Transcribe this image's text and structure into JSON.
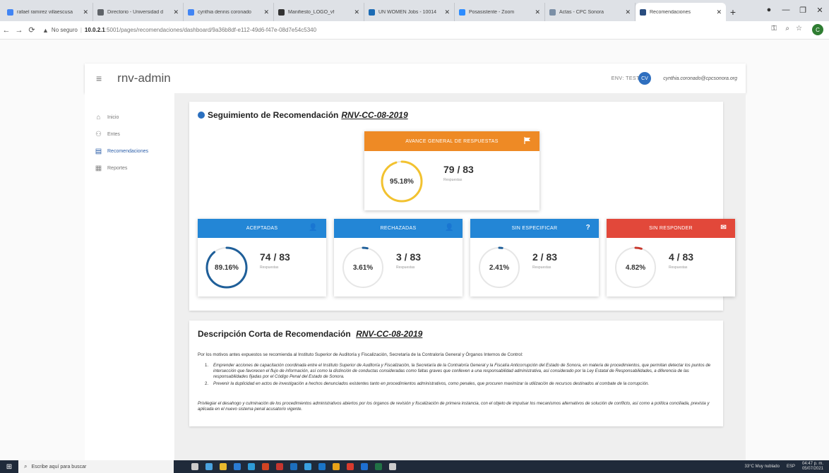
{
  "browser": {
    "tabs": [
      {
        "label": "rafael ramirez villaescusa",
        "color": "#4285f4"
      },
      {
        "label": "Directorio - Universidad d",
        "color": "#5f6368"
      },
      {
        "label": "cynthia dennis coronado",
        "color": "#4285f4"
      },
      {
        "label": "Manifiesto_LOGO_vf",
        "color": "#333333"
      },
      {
        "label": "UN WOMEN Jobs - 10014",
        "color": "#1c6bb4"
      },
      {
        "label": "Posasistente - Zoom",
        "color": "#2d8cff"
      },
      {
        "label": "Actas - CPC Sonora",
        "color": "#7b8fa6"
      },
      {
        "label": "Recomendaciones",
        "color": "#2a4d7f",
        "active": true
      }
    ],
    "url_security": "No seguro",
    "url_host": "10.0.2.1",
    "url_path": ":5001/pages/recomendaciones/dashboard/9a36b8df-e112-49d6-f47e-08d7e54c5340",
    "profile_initial": "C"
  },
  "app": {
    "name": "rnv-admin",
    "env": "ENV: TEST",
    "user_initials": "CV",
    "user_email": "cynthia.coronado@cpcsonora.org"
  },
  "sidebar": {
    "items": [
      {
        "label": "Inicio",
        "icon": "home-icon"
      },
      {
        "label": "Entes",
        "icon": "users-icon"
      },
      {
        "label": "Recomendaciones",
        "icon": "document-icon",
        "active": true
      },
      {
        "label": "Reportes",
        "icon": "calendar-icon"
      }
    ]
  },
  "tracking": {
    "title": "Seguimiento de Recomendación",
    "code": "RNV-CC-08-2019",
    "general": {
      "header": "AVANCE GENERAL DE RESPUESTAS",
      "percent_label": "95.18%",
      "percent": 95.18,
      "fraction": "79 / 83",
      "sub": "Respuestas",
      "color": "#ee8a25",
      "ring_color": "#f2c230"
    },
    "stats": [
      {
        "header": "ACEPTADAS",
        "fraction": "74 / 83",
        "percent_label": "89.16%",
        "percent": 89.16,
        "sub": "Respuestas",
        "color": "#2386d6",
        "ring_color": "#1f5f99",
        "icon": "user-check-icon",
        "glyph": "👤"
      },
      {
        "header": "RECHAZADAS",
        "fraction": "3 / 83",
        "percent_label": "3.61%",
        "percent": 3.61,
        "sub": "Respuestas",
        "color": "#2386d6",
        "ring_color": "#1f5f99",
        "icon": "user-x-icon",
        "glyph": "👤"
      },
      {
        "header": "SIN ESPECIFICAR",
        "fraction": "2 / 83",
        "percent_label": "2.41%",
        "percent": 2.41,
        "sub": "Respuestas",
        "color": "#2386d6",
        "ring_color": "#1f5f99",
        "icon": "question-icon",
        "glyph": "?"
      },
      {
        "header": "SIN RESPONDER",
        "fraction": "4 / 83",
        "percent_label": "4.82%",
        "percent": 4.82,
        "sub": "Respuestas",
        "color": "#e2483a",
        "ring_color": "#c8382d",
        "icon": "no-reply-icon",
        "glyph": "✉"
      }
    ]
  },
  "description": {
    "title": "Descripción Corta de Recomendación",
    "code": "RNV-CC-08-2019",
    "intro": "Por los motivos antes expuestos se recomienda al Instituto Superior de Auditoría y Fiscalización, Secretaría de la Contraloría General y Órganos Internos de Control:",
    "items": [
      "Emprender acciones de capacitación coordinada entre el Instituto Superior de Auditoría y Fiscalización, la Secretaría de la Contraloría General y la Fiscalía Anticorrupción del Estado de Sonora, en materia de procedimientos, que permitan detectar los puntos de intersección que favorecen el flujo de información, así como la distinción de conductas consideradas como faltas graves que conlleven a una responsabilidad administrativa, así considerado por la Ley Estatal de Responsabilidades, a diferencia de las responsabilidades fijadas por el Código Penal del Estado de Sonora.",
      "Prevenir la duplicidad en actos de investigación a hechos denunciados existentes tanto en procedimientos administrativos, como penales, que procuren maximizar la utilización de recursos destinados al combate de la corrupción."
    ],
    "footer": "Privilegiar el desahogo y culminación de los procedimientos administrativos abiertos por los órganos de revisión y fiscalización de primera instancia, con el objeto de impulsar los mecanismos alternativos de solución de conflicto, así como a política conciliada, prevista y aplicada en el nuevo sistema penal acusatorio vigente."
  },
  "taskbar": {
    "search_placeholder": "Escribe aquí para buscar",
    "weather": "33°C  Muy nublado",
    "lang": "ESP",
    "time": "04:47 p. m.",
    "date": "05/07/2021"
  }
}
